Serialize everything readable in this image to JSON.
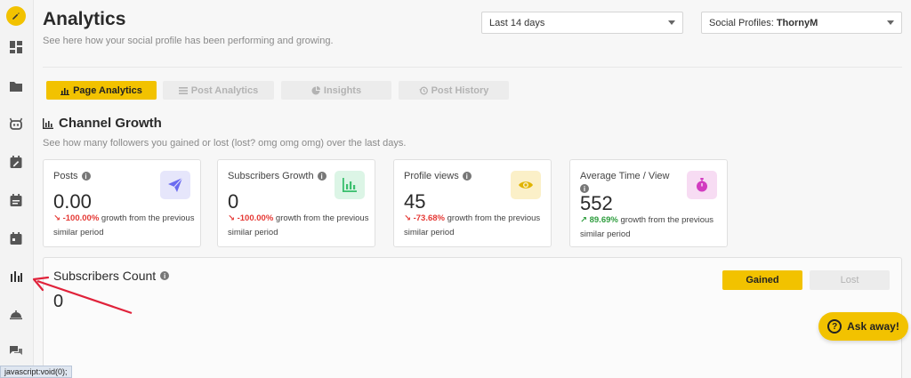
{
  "page": {
    "title": "Analytics",
    "subtitle": "See here how your social profile has been performing and growing."
  },
  "filters": {
    "date_range": "Last 14 days",
    "profile_label": "Social Profiles:",
    "profile_value": "ThornyM"
  },
  "tabs": [
    {
      "label": "Page Analytics",
      "active": true
    },
    {
      "label": "Post Analytics",
      "active": false
    },
    {
      "label": "Insights",
      "active": false
    },
    {
      "label": "Post History",
      "active": false
    }
  ],
  "channel_growth": {
    "title": "Channel Growth",
    "subtitle": "See how many followers you gained or lost (lost? omg omg omg) over the last days."
  },
  "cards": [
    {
      "label": "Posts",
      "value": "0.00",
      "change": "-100.00%",
      "trend": "down",
      "growth_text": "growth from the previous similar period",
      "icon": "paper-plane-icon",
      "icon_bg": "#e6e6fb",
      "icon_color": "#6b6bf0"
    },
    {
      "label": "Subscribers Growth",
      "value": "0",
      "change": "-100.00%",
      "trend": "down",
      "growth_text": "growth from the previous similar period",
      "icon": "bar-chart-icon",
      "icon_bg": "#dcf5e6",
      "icon_color": "#3bbf6e"
    },
    {
      "label": "Profile views",
      "value": "45",
      "change": "-73.68%",
      "trend": "down",
      "growth_text": "growth from the previous similar period",
      "icon": "eye-icon",
      "icon_bg": "#fbf0c8",
      "icon_color": "#e0b400"
    },
    {
      "label": "Average Time / View",
      "value": "552",
      "change": "89.69%",
      "trend": "up",
      "growth_text": "growth from the previous similar period",
      "icon": "stopwatch-icon",
      "icon_bg": "#f7dcf3",
      "icon_color": "#d23cc0"
    }
  ],
  "subscribers_count": {
    "title": "Subscribers Count",
    "value": "0",
    "gained_label": "Gained",
    "lost_label": "Lost"
  },
  "ask_away": {
    "label": "Ask away!"
  },
  "status_bar": {
    "text": "javascript:void(0);"
  },
  "colors": {
    "accent": "#f2c200",
    "negative": "#e53935",
    "positive": "#2e9d3e",
    "annotation_arrow": "#e0223a"
  }
}
